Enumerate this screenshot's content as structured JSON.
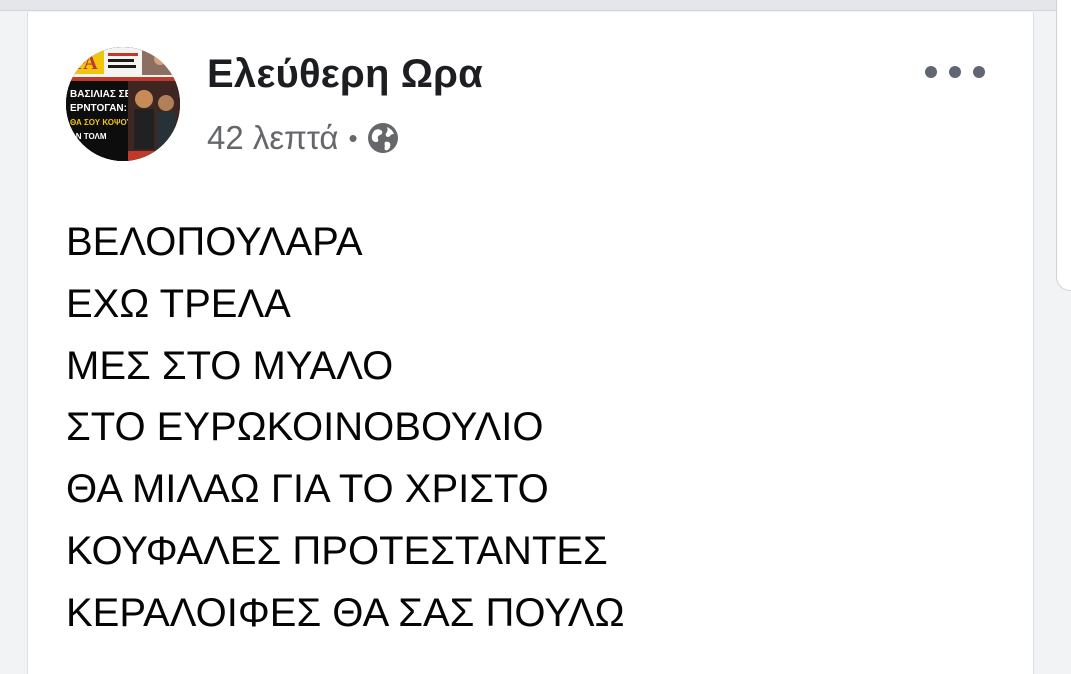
{
  "post": {
    "author": "Ελεύθερη Ωρα",
    "time": "42 λεπτά",
    "separator": "•",
    "privacy_icon": "globe-icon",
    "more_icon": "more-options-icon",
    "avatar": {
      "description_icon": "newspaper-avatar",
      "headline_lines": [
        "ΒΑΣΙΛΙΑΣ ΣΕ",
        "ΕΡΝΤΟΓΑΝ:",
        "ΘΑ ΣΟΥ ΚΟΨΟΥΜΕ ΤΑ",
        "...ΑΝ ΤΟΛΜΗΣΕΙΣ"
      ],
      "masthead": "ΩΡΑ"
    },
    "lines": [
      "ΒΕΛΟΠΟΥΛΑΡΑ",
      "ΕΧΩ ΤΡΕΛΑ",
      "ΜΕΣ ΣΤΟ ΜΥΑΛΟ",
      "ΣΤΟ ΕΥΡΩΚΟΙΝΟΒΟΥΛΙΟ",
      "ΘΑ ΜΙΛΑΩ ΓΙΑ ΤΟ ΧΡΙΣΤΟ",
      "ΚΟΥΦΑΛΕΣ ΠΡΟΤΕΣΤΑΝΤΕΣ",
      "ΚΕΡΑΛΟΙΦΕΣ ΘΑ ΣΑΣ ΠΟΥΛΩ"
    ]
  },
  "colors": {
    "name": "#1c1e21",
    "meta": "#65676b",
    "text": "#050505",
    "background": "#f2f3f5"
  }
}
